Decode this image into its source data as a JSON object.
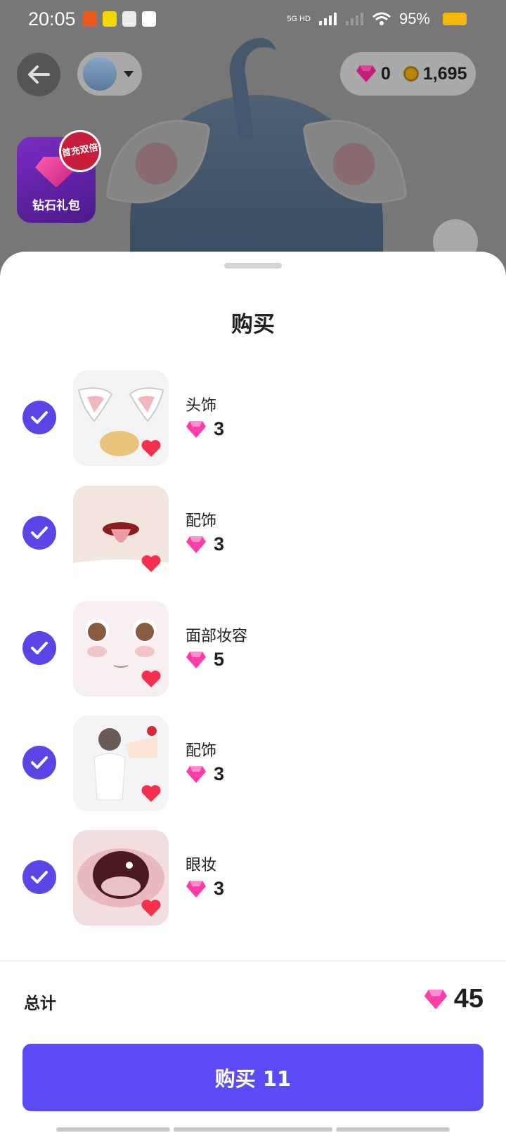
{
  "status_bar": {
    "time": "20:05",
    "network": "5G HD",
    "battery": "95%"
  },
  "top": {
    "diamonds": "0",
    "coins": "1,695"
  },
  "promo": {
    "label": "钻石礼包",
    "badge": "首充双倍"
  },
  "sheet": {
    "title": "购买",
    "items": [
      {
        "name": "头饰",
        "price": "3"
      },
      {
        "name": "配饰",
        "price": "3"
      },
      {
        "name": "面部妆容",
        "price": "5"
      },
      {
        "name": "配饰",
        "price": "3"
      },
      {
        "name": "眼妆",
        "price": "3"
      }
    ],
    "total_label": "总计",
    "total_value": "45",
    "buy_button": "购买 11"
  },
  "colors": {
    "accent": "#5b4bf5",
    "check": "#5a45e6",
    "gem": "#ff3da8",
    "heart": "#f5304f"
  }
}
